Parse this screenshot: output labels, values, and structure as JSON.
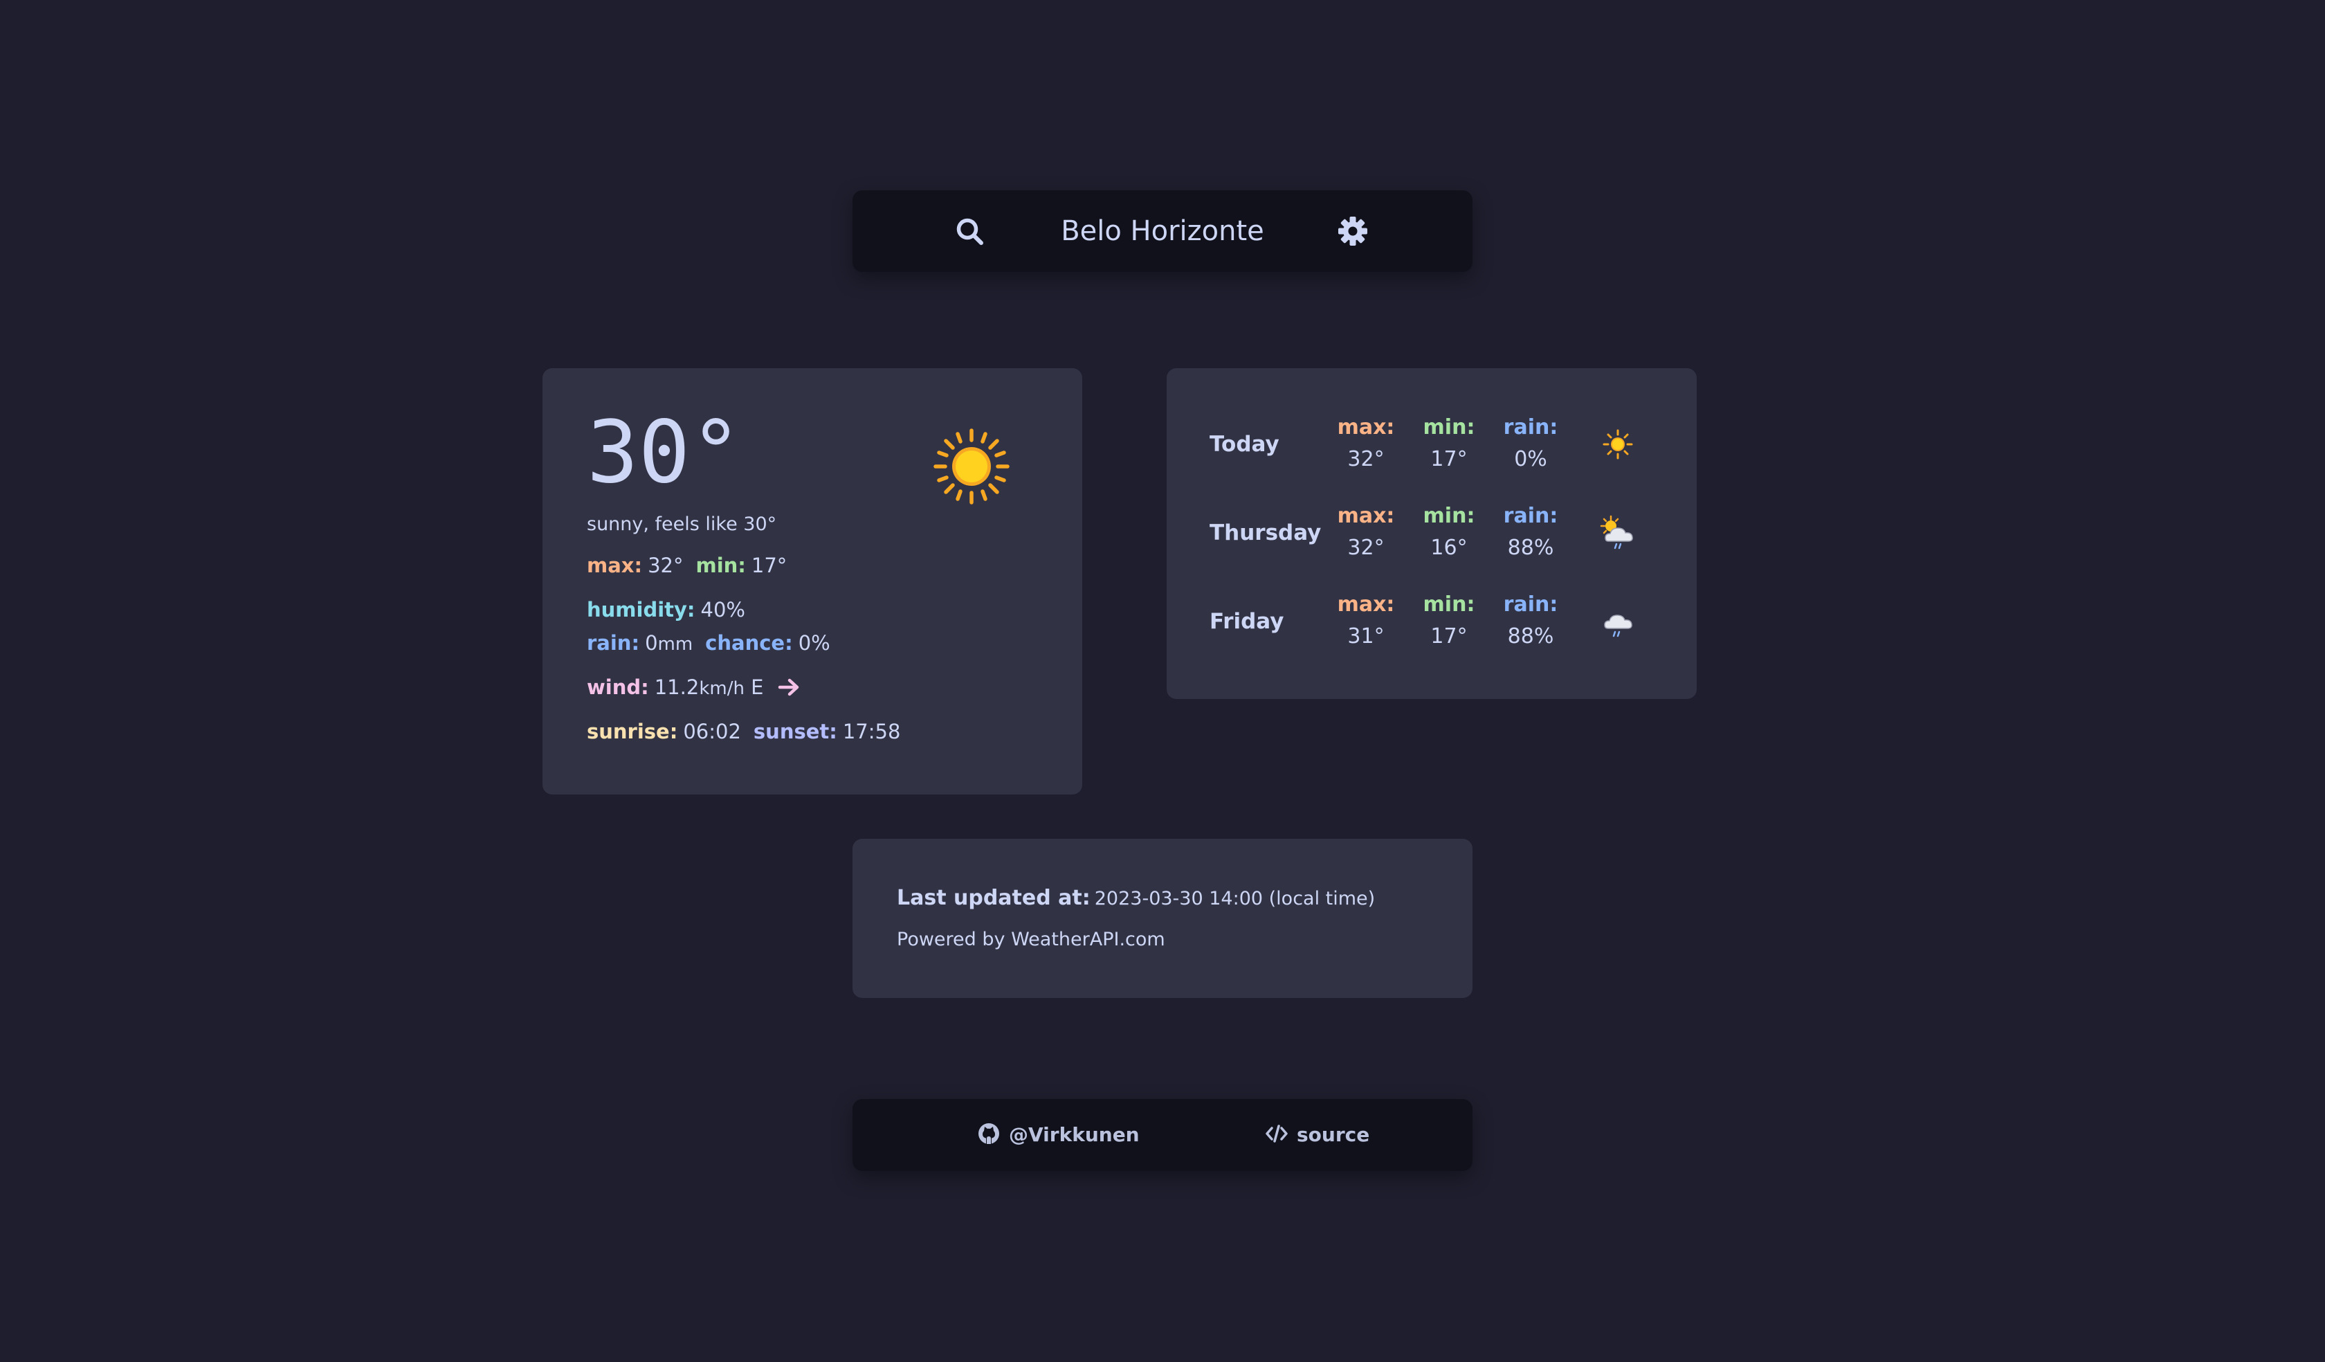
{
  "search": {
    "city": "Belo Horizonte"
  },
  "current": {
    "temperature": "30°",
    "description": "sunny, feels like 30°",
    "max_label": "max:",
    "max_value": "32°",
    "min_label": "min:",
    "min_value": "17°",
    "humidity_label": "humidity:",
    "humidity_value": "40%",
    "rain_label": "rain:",
    "rain_value": "0",
    "rain_unit": "mm",
    "chance_label": "chance:",
    "chance_value": "0%",
    "wind_label": "wind:",
    "wind_value": "11.2",
    "wind_unit": "km/h",
    "wind_direction": "E",
    "sunrise_label": "sunrise:",
    "sunrise_value": "06:02",
    "sunset_label": "sunset:",
    "sunset_value": "17:58",
    "icon": "sun-icon"
  },
  "forecast": [
    {
      "day": "Today",
      "max_label": "max:",
      "max": "32°",
      "min_label": "min:",
      "min": "17°",
      "rain_label": "rain:",
      "rain": "0%",
      "icon": "sun-icon"
    },
    {
      "day": "Thursday",
      "max_label": "max:",
      "max": "32°",
      "min_label": "min:",
      "min": "16°",
      "rain_label": "rain:",
      "rain": "88%",
      "icon": "sun-cloud-rain-icon"
    },
    {
      "day": "Friday",
      "max_label": "max:",
      "max": "31°",
      "min_label": "min:",
      "min": "17°",
      "rain_label": "rain:",
      "rain": "88%",
      "icon": "cloud-rain-icon"
    }
  ],
  "updated": {
    "label": "Last updated at:",
    "value": "2023-03-30 14:00 (local time)",
    "powered_by": "Powered by WeatherAPI.com"
  },
  "footer": {
    "github_label": "@Virkkunen",
    "source_label": "source"
  },
  "colors": {
    "background": "#1e1e2e",
    "panel": "#313244",
    "panel_dark": "#11111b",
    "text": "#cdd6f4",
    "max": "#fab387",
    "min": "#a6e3a1",
    "humidity": "#89dceb",
    "rain": "#89b4fa",
    "wind": "#f5c2e7",
    "sunrise": "#f9e2af",
    "sunset": "#b4befe"
  }
}
